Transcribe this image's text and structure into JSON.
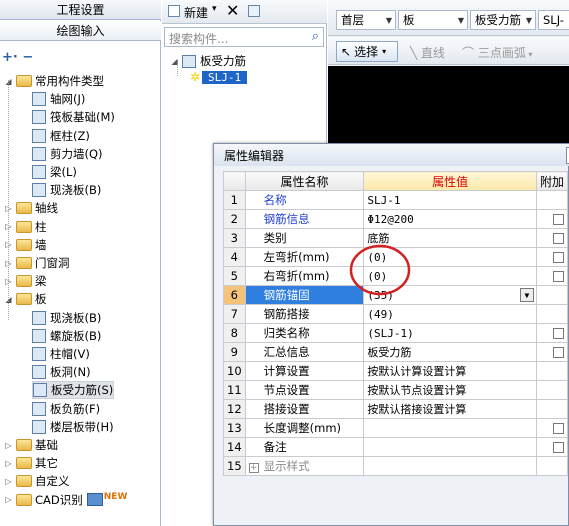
{
  "left_panel": {
    "tab_settings": "工程设置",
    "tab_drawing": "绘图输入",
    "tree": [
      {
        "label": "常用构件类型",
        "level": 0,
        "expanded": true,
        "type": "folder"
      },
      {
        "label": "轴网(J)",
        "level": 1,
        "type": "item",
        "icon": "grid-icon"
      },
      {
        "label": "筏板基础(M)",
        "level": 1,
        "type": "item",
        "icon": "raft-foundation-icon"
      },
      {
        "label": "框柱(Z)",
        "level": 1,
        "type": "item",
        "icon": "column-icon"
      },
      {
        "label": "剪力墙(Q)",
        "level": 1,
        "type": "item",
        "icon": "shear-wall-icon"
      },
      {
        "label": "梁(L)",
        "level": 1,
        "type": "item",
        "icon": "beam-icon"
      },
      {
        "label": "现浇板(B)",
        "level": 1,
        "type": "item",
        "icon": "slab-icon"
      },
      {
        "label": "轴线",
        "level": 0,
        "expanded": false,
        "type": "folder"
      },
      {
        "label": "柱",
        "level": 0,
        "expanded": false,
        "type": "folder"
      },
      {
        "label": "墙",
        "level": 0,
        "expanded": false,
        "type": "folder"
      },
      {
        "label": "门窗洞",
        "level": 0,
        "expanded": false,
        "type": "folder"
      },
      {
        "label": "梁",
        "level": 0,
        "expanded": false,
        "type": "folder"
      },
      {
        "label": "板",
        "level": 0,
        "expanded": true,
        "type": "folder"
      },
      {
        "label": "现浇板(B)",
        "level": 1,
        "type": "item",
        "icon": "slab-icon"
      },
      {
        "label": "螺旋板(B)",
        "level": 1,
        "type": "item",
        "icon": "spiral-slab-icon"
      },
      {
        "label": "柱帽(V)",
        "level": 1,
        "type": "item",
        "icon": "column-cap-icon"
      },
      {
        "label": "板洞(N)",
        "level": 1,
        "type": "item",
        "icon": "slab-hole-icon"
      },
      {
        "label": "板受力筋(S)",
        "level": 1,
        "type": "item",
        "icon": "slab-rebar-icon",
        "selected": true
      },
      {
        "label": "板负筋(F)",
        "level": 1,
        "type": "item",
        "icon": "negative-rebar-icon"
      },
      {
        "label": "楼层板带(H)",
        "level": 1,
        "type": "item",
        "icon": "slab-strip-icon"
      },
      {
        "label": "基础",
        "level": 0,
        "expanded": false,
        "type": "folder"
      },
      {
        "label": "其它",
        "level": 0,
        "expanded": false,
        "type": "folder"
      },
      {
        "label": "自定义",
        "level": 0,
        "expanded": false,
        "type": "folder"
      },
      {
        "label": "CAD识别",
        "level": 0,
        "expanded": false,
        "type": "folder",
        "badge": "NEW"
      }
    ]
  },
  "middle_panel": {
    "new_button": "新建",
    "search_placeholder": "搜索构件...",
    "tree_root": "板受力筋",
    "tree_child": "SLJ-1"
  },
  "right_panel": {
    "floor_combo": "首层",
    "type_combo": "板",
    "category_combo": "板受力筋",
    "member_combo": "SLJ-",
    "select_button": "选择",
    "line_button": "直线",
    "arc_button": "三点画弧"
  },
  "dialog": {
    "title": "属性编辑器",
    "columns": [
      "属性名称",
      "属性值",
      "附加"
    ],
    "rows": [
      {
        "num": "1",
        "name": "名称",
        "value": "SLJ-1",
        "blue": true,
        "check": false
      },
      {
        "num": "2",
        "name": "钢筋信息",
        "value": "Φ12@200",
        "blue": true,
        "check": true
      },
      {
        "num": "3",
        "name": "类别",
        "value": "底筋",
        "blue": false,
        "check": true
      },
      {
        "num": "4",
        "name": "左弯折(mm)",
        "value": "(0)",
        "blue": false,
        "check": true
      },
      {
        "num": "5",
        "name": "右弯折(mm)",
        "value": "(0)",
        "blue": false,
        "check": true
      },
      {
        "num": "6",
        "name": "钢筋锚固",
        "value": "(35)",
        "blue": false,
        "check": false,
        "selected": true
      },
      {
        "num": "7",
        "name": "钢筋搭接",
        "value": "(49)",
        "blue": false,
        "check": false
      },
      {
        "num": "8",
        "name": "归类名称",
        "value": "(SLJ-1)",
        "blue": false,
        "check": true
      },
      {
        "num": "9",
        "name": "汇总信息",
        "value": "板受力筋",
        "blue": false,
        "check": true
      },
      {
        "num": "10",
        "name": "计算设置",
        "value": "按默认计算设置计算",
        "blue": false,
        "check": false
      },
      {
        "num": "11",
        "name": "节点设置",
        "value": "按默认节点设置计算",
        "blue": false,
        "check": false
      },
      {
        "num": "12",
        "name": "搭接设置",
        "value": "按默认搭接设置计算",
        "blue": false,
        "check": false
      },
      {
        "num": "13",
        "name": "长度调整(mm)",
        "value": "",
        "blue": false,
        "check": true
      },
      {
        "num": "14",
        "name": "备注",
        "value": "",
        "blue": false,
        "check": true
      },
      {
        "num": "15",
        "name": "显示样式",
        "value": "",
        "blue": false,
        "check": false,
        "expandable": true
      }
    ]
  },
  "colors": {
    "accent": "#2f7fe0",
    "blue_text": "#1f3fd0",
    "annotation_circle": "#d42020"
  }
}
